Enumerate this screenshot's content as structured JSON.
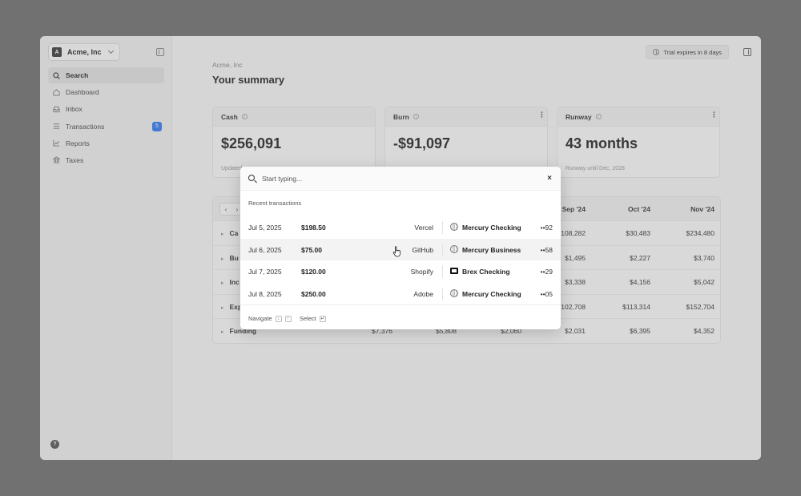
{
  "sidebar": {
    "org_initial": "A",
    "org_name": "Acme, Inc",
    "items": [
      {
        "label": "Search",
        "icon": "search-icon",
        "active": true
      },
      {
        "label": "Dashboard",
        "icon": "home-icon"
      },
      {
        "label": "Inbox",
        "icon": "inbox-icon"
      },
      {
        "label": "Transactions",
        "icon": "list-icon",
        "badge": "5"
      },
      {
        "label": "Reports",
        "icon": "chart-icon"
      },
      {
        "label": "Taxes",
        "icon": "bank-icon"
      }
    ],
    "help": "?"
  },
  "header": {
    "trial_text": "Trial expires in 8 days",
    "breadcrumb": "Acme, Inc",
    "title": "Your summary"
  },
  "cards": [
    {
      "title": "Cash",
      "value": "$256,091",
      "footer": "Updated"
    },
    {
      "title": "Burn",
      "value": "-$91,097",
      "footer": ""
    },
    {
      "title": "Runway",
      "value": "43 months",
      "footer": "Runway until Dec, 2028"
    }
  ],
  "table": {
    "pager_prev": "‹",
    "pager_next": "›",
    "columns": [
      "Sep '24",
      "Oct '24",
      "Nov '24"
    ],
    "rows": [
      {
        "label": "Ca",
        "values": [
          "$108,282",
          "$30,483",
          "$234,480"
        ]
      },
      {
        "label": "Bu",
        "values": [
          "$1,495",
          "$2,227",
          "$3,740"
        ]
      },
      {
        "label": "Inc",
        "values": [
          "$3,338",
          "$4,156",
          "$5,042"
        ]
      },
      {
        "label": "Exp",
        "values": [
          "$102,708",
          "$113,314",
          "$152,704"
        ]
      },
      {
        "label": "Funding",
        "values": [
          "$7,376",
          "$5,808",
          "$2,060",
          "$2,031",
          "$6,395",
          "$4,352"
        ]
      }
    ]
  },
  "search_modal": {
    "placeholder": "Start typing...",
    "close": "×",
    "section_label": "Recent transactions",
    "transactions": [
      {
        "date": "Jul 5, 2025",
        "amount": "$198.50",
        "merchant": "Vercel",
        "account": "Mercury Checking",
        "account_icon": "mercury-icon",
        "mask": "••92"
      },
      {
        "date": "Jul 6, 2025",
        "amount": "$75.00",
        "merchant": "GitHub",
        "account": "Mercury Business",
        "account_icon": "mercury-icon",
        "mask": "••58"
      },
      {
        "date": "Jul 7, 2025",
        "amount": "$120.00",
        "merchant": "Shopify",
        "account": "Brex Checking",
        "account_icon": "brex-icon",
        "mask": "••29"
      },
      {
        "date": "Jul 8, 2025",
        "amount": "$250.00",
        "merchant": "Adobe",
        "account": "Mercury Checking",
        "account_icon": "mercury-icon",
        "mask": "••05"
      }
    ],
    "footer": {
      "navigate_label": "Navigate",
      "navigate_keys": [
        "↓",
        "↑"
      ],
      "select_label": "Select",
      "select_key": "↵"
    }
  },
  "colors": {
    "accent": "#2f7bf5",
    "backdrop": "#6f6f6f"
  }
}
